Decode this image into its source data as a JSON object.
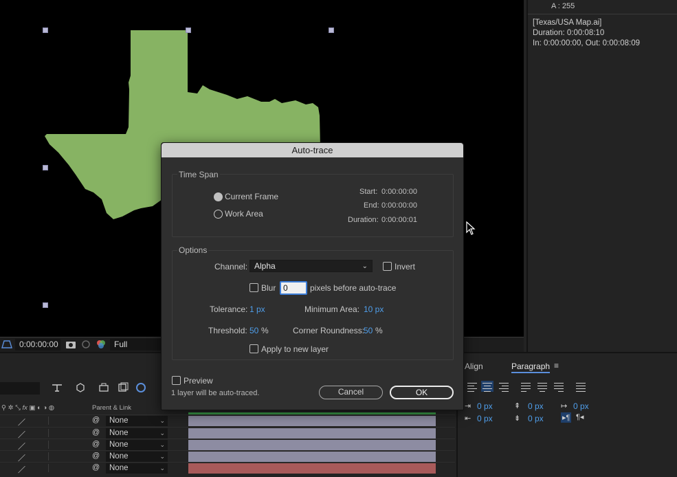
{
  "info_panel": {
    "alpha": "A :  255",
    "file": "[Texas/USA Map.ai]",
    "duration": "Duration: 0:00:08:10",
    "in_out": "In: 0:00:00:00, Out: 0:00:08:09"
  },
  "viewer": {
    "timecode": "0:00:00:00",
    "resolution": "Full",
    "shape_color": "#87b363"
  },
  "timeline": {
    "header_parent": "Parent & Link",
    "rows": [
      {
        "parent": "None",
        "bar": "purple"
      },
      {
        "parent": "None",
        "bar": "purple"
      },
      {
        "parent": "None",
        "bar": "purple"
      },
      {
        "parent": "None",
        "bar": "purple"
      },
      {
        "parent": "None",
        "bar": "red"
      }
    ]
  },
  "paragraph_panel": {
    "tab_align": "Align",
    "tab_paragraph": "Paragraph",
    "menu": "≡",
    "values": [
      "0 px",
      "0 px",
      "0 px",
      "0 px",
      "0 px"
    ]
  },
  "dialog": {
    "title": "Auto-trace",
    "time_span": {
      "label": "Time Span",
      "current_frame": "Current Frame",
      "work_area": "Work Area",
      "start_label": "Start:",
      "start": "0:00:00:00",
      "end_label": "End:",
      "end": "0:00:00:00",
      "duration_label": "Duration:",
      "duration": "0:00:00:01"
    },
    "options": {
      "label": "Options",
      "channel_label": "Channel:",
      "channel_value": "Alpha",
      "invert": "Invert",
      "blur": "Blur",
      "blur_value": "0",
      "blur_suffix": "pixels before auto-trace",
      "tolerance_label": "Tolerance:",
      "tolerance_value": "1 px",
      "min_area_label": "Minimum Area:",
      "min_area_value": "10 px",
      "threshold_label": "Threshold:",
      "threshold_value": "50",
      "threshold_unit": "%",
      "corner_label": "Corner Roundness:",
      "corner_value": "50",
      "corner_unit": "%",
      "apply_new_layer": "Apply to new layer"
    },
    "preview": "Preview",
    "note": "1 layer will be auto-traced.",
    "cancel": "Cancel",
    "ok": "OK"
  },
  "colors": {
    "accent_blue": "#4f9eea",
    "timeline_bar": "#8d8ca2",
    "timeline_bar_red": "#a85a5a"
  }
}
